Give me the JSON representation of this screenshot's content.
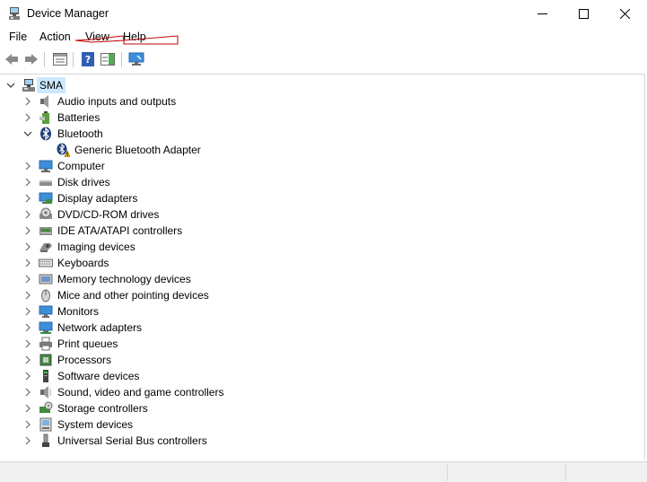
{
  "window": {
    "title": "Device Manager",
    "minimize_icon": "minimize-icon",
    "maximize_icon": "maximize-icon",
    "close_icon": "close-icon"
  },
  "menu": {
    "items": [
      "File",
      "Action",
      "View",
      "Help"
    ]
  },
  "toolbar": {
    "buttons": [
      "back-arrow-icon",
      "forward-arrow-icon",
      "properties-icon",
      "help-icon",
      "action-pane-icon",
      "monitor-scan-icon"
    ]
  },
  "tree": {
    "root": {
      "label": "SMA",
      "icon": "computer-root-icon",
      "expanded": true
    },
    "categories": [
      {
        "label": "Audio inputs and outputs",
        "icon": "speaker-icon",
        "expanded": false
      },
      {
        "label": "Batteries",
        "icon": "battery-icon",
        "expanded": false
      },
      {
        "label": "Bluetooth",
        "icon": "bluetooth-icon",
        "expanded": true,
        "children": [
          {
            "label": "Generic Bluetooth Adapter",
            "icon": "bluetooth-warning-icon"
          }
        ]
      },
      {
        "label": "Computer",
        "icon": "computer-icon",
        "expanded": false
      },
      {
        "label": "Disk drives",
        "icon": "disk-drive-icon",
        "expanded": false
      },
      {
        "label": "Display adapters",
        "icon": "display-adapter-icon",
        "expanded": false
      },
      {
        "label": "DVD/CD-ROM drives",
        "icon": "dvd-drive-icon",
        "expanded": false
      },
      {
        "label": "IDE ATA/ATAPI controllers",
        "icon": "ide-controller-icon",
        "expanded": false
      },
      {
        "label": "Imaging devices",
        "icon": "camera-icon",
        "expanded": false
      },
      {
        "label": "Keyboards",
        "icon": "keyboard-icon",
        "expanded": false
      },
      {
        "label": "Memory technology devices",
        "icon": "memory-icon",
        "expanded": false
      },
      {
        "label": "Mice and other pointing devices",
        "icon": "mouse-icon",
        "expanded": false
      },
      {
        "label": "Monitors",
        "icon": "monitor-icon",
        "expanded": false
      },
      {
        "label": "Network adapters",
        "icon": "network-adapter-icon",
        "expanded": false
      },
      {
        "label": "Print queues",
        "icon": "printer-icon",
        "expanded": false
      },
      {
        "label": "Processors",
        "icon": "processor-icon",
        "expanded": false
      },
      {
        "label": "Software devices",
        "icon": "software-device-icon",
        "expanded": false
      },
      {
        "label": "Sound, video and game controllers",
        "icon": "sound-icon",
        "expanded": false
      },
      {
        "label": "Storage controllers",
        "icon": "storage-controller-icon",
        "expanded": false
      },
      {
        "label": "System devices",
        "icon": "system-device-icon",
        "expanded": false
      },
      {
        "label": "Universal Serial Bus controllers",
        "icon": "usb-icon",
        "expanded": false
      }
    ]
  },
  "colors": {
    "selection": "#cce8ff",
    "annotation_red": "#c00000",
    "icon_blue": "#3c8ed8",
    "warning_yellow": "#f5c400"
  }
}
